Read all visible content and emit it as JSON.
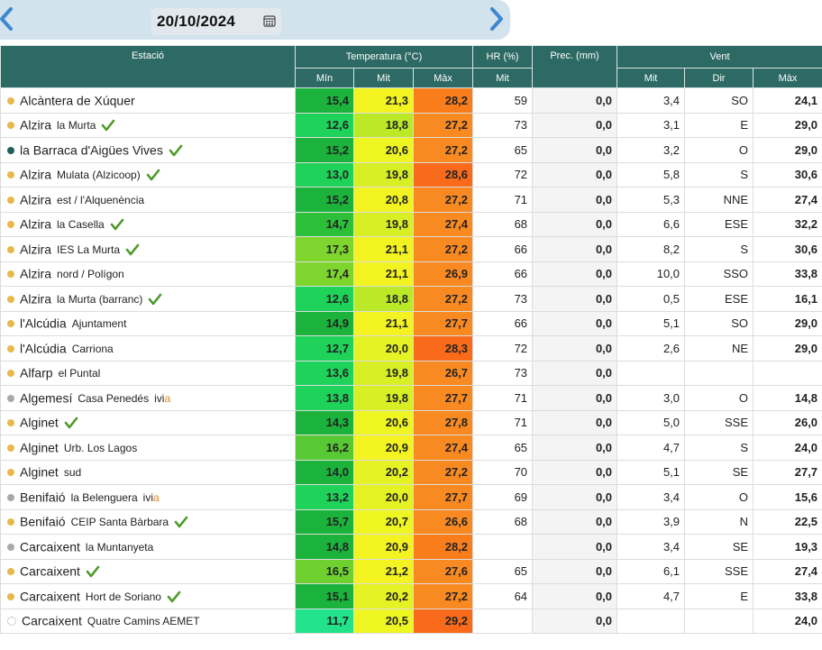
{
  "header": {
    "date": "20/10/2024",
    "prev_icon": "chevron-left-icon",
    "next_icon": "chevron-right-icon",
    "calendar_icon": "calendar-icon"
  },
  "columns": {
    "station": "Estació",
    "temperature": "Temperatura (°C)",
    "humidity": "HR (%)",
    "precipitation": "Prec. (mm)",
    "wind": "Vent",
    "t_min": "Mín",
    "t_mit": "Mit",
    "t_max": "Màx",
    "hr_mit": "Mit",
    "w_mit": "Mit",
    "w_dir": "Dir",
    "w_max": "Màx"
  },
  "colors": {
    "header_bg": "#2d6a65",
    "dot_yellow": "#e8b84a",
    "dot_teal": "#1e5f5a",
    "dot_gray": "#a9a9a9",
    "check": "#4c9a2a",
    "ivia_accent": "#e08a1e"
  },
  "stations": [
    {
      "name": "Alcàntera de Xúquer",
      "sub": "",
      "dot": "yellow",
      "check": false,
      "ivia": false,
      "tmin": "15,4",
      "tmit": "21,3",
      "tmax": "28,2",
      "hr": "59",
      "prec": "0,0",
      "wmit": "3,4",
      "wdir": "SO",
      "wmax": "24,1",
      "cmin": "#1bb33c",
      "cmit": "#f3f321",
      "cmax": "#fa7d1c"
    },
    {
      "name": "Alzira",
      "sub": "la Murta",
      "dot": "yellow",
      "check": true,
      "ivia": false,
      "tmin": "12,6",
      "tmit": "18,8",
      "tmax": "27,2",
      "hr": "73",
      "prec": "0,0",
      "wmit": "3,1",
      "wdir": "E",
      "wmax": "29,0",
      "cmin": "#1fd25a",
      "cmit": "#bbe928",
      "cmax": "#f98a22"
    },
    {
      "name": "la Barraca d'Aigües Vives",
      "sub": "",
      "dot": "teal",
      "check": true,
      "ivia": false,
      "tmin": "15,2",
      "tmit": "20,6",
      "tmax": "27,2",
      "hr": "65",
      "prec": "0,0",
      "wmit": "3,2",
      "wdir": "O",
      "wmax": "29,0",
      "cmin": "#1bb33c",
      "cmit": "#eef622",
      "cmax": "#f98a22"
    },
    {
      "name": "Alzira",
      "sub": "Mulata (Alzicoop)",
      "dot": "yellow",
      "check": true,
      "ivia": false,
      "tmin": "13,0",
      "tmit": "19,8",
      "tmax": "28,6",
      "hr": "72",
      "prec": "0,0",
      "wmit": "5,8",
      "wdir": "S",
      "wmax": "30,6",
      "cmin": "#1fd25a",
      "cmit": "#d8ef25",
      "cmax": "#f96a1a"
    },
    {
      "name": "Alzira",
      "sub": "est / l'Alquenència",
      "dot": "yellow",
      "check": false,
      "ivia": false,
      "tmin": "15,2",
      "tmit": "20,8",
      "tmax": "27,2",
      "hr": "71",
      "prec": "0,0",
      "wmit": "5,3",
      "wdir": "NNE",
      "wmax": "27,4",
      "cmin": "#1bb33c",
      "cmit": "#f3f321",
      "cmax": "#f98a22"
    },
    {
      "name": "Alzira",
      "sub": "la Casella",
      "dot": "yellow",
      "check": true,
      "ivia": false,
      "tmin": "14,7",
      "tmit": "19,8",
      "tmax": "27,4",
      "hr": "68",
      "prec": "0,0",
      "wmit": "6,6",
      "wdir": "ESE",
      "wmax": "32,2",
      "cmin": "#2cbf3a",
      "cmit": "#d8ef25",
      "cmax": "#f98a22"
    },
    {
      "name": "Alzira",
      "sub": "IES La Murta",
      "dot": "yellow",
      "check": true,
      "ivia": false,
      "tmin": "17,3",
      "tmit": "21,1",
      "tmax": "27,2",
      "hr": "66",
      "prec": "0,0",
      "wmit": "8,2",
      "wdir": "S",
      "wmax": "30,6",
      "cmin": "#7dd52e",
      "cmit": "#f3f321",
      "cmax": "#f98a22"
    },
    {
      "name": "Alzira",
      "sub": "nord / Polígon",
      "dot": "yellow",
      "check": false,
      "ivia": false,
      "tmin": "17,4",
      "tmit": "21,1",
      "tmax": "26,9",
      "hr": "66",
      "prec": "0,0",
      "wmit": "10,0",
      "wdir": "SSO",
      "wmax": "33,8",
      "cmin": "#7dd52e",
      "cmit": "#f3f321",
      "cmax": "#f98a22"
    },
    {
      "name": "Alzira",
      "sub": "la Murta (barranc)",
      "dot": "yellow",
      "check": true,
      "ivia": false,
      "tmin": "12,6",
      "tmit": "18,8",
      "tmax": "27,2",
      "hr": "73",
      "prec": "0,0",
      "wmit": "0,5",
      "wdir": "ESE",
      "wmax": "16,1",
      "cmin": "#1fd25a",
      "cmit": "#bbe928",
      "cmax": "#f98a22"
    },
    {
      "name": "l'Alcúdia",
      "sub": "Ajuntament",
      "dot": "yellow",
      "check": false,
      "ivia": false,
      "tmin": "14,9",
      "tmit": "21,1",
      "tmax": "27,7",
      "hr": "66",
      "prec": "0,0",
      "wmit": "5,1",
      "wdir": "SO",
      "wmax": "29,0",
      "cmin": "#1bb33c",
      "cmit": "#f3f321",
      "cmax": "#f98a22"
    },
    {
      "name": "l'Alcúdia",
      "sub": "Carriona",
      "dot": "yellow",
      "check": false,
      "ivia": false,
      "tmin": "12,7",
      "tmit": "20,0",
      "tmax": "28,3",
      "hr": "72",
      "prec": "0,0",
      "wmit": "2,6",
      "wdir": "NE",
      "wmax": "29,0",
      "cmin": "#1fd25a",
      "cmit": "#e5f223",
      "cmax": "#f96a1a"
    },
    {
      "name": "Alfarp",
      "sub": "el Puntal",
      "dot": "yellow",
      "check": false,
      "ivia": false,
      "tmin": "13,6",
      "tmit": "19,8",
      "tmax": "26,7",
      "hr": "73",
      "prec": "0,0",
      "wmit": "",
      "wdir": "",
      "wmax": "",
      "cmin": "#1fd25a",
      "cmit": "#d8ef25",
      "cmax": "#f98a22"
    },
    {
      "name": "Algemesí",
      "sub": "Casa Penedés",
      "dot": "gray",
      "check": false,
      "ivia": true,
      "tmin": "13,8",
      "tmit": "19,8",
      "tmax": "27,7",
      "hr": "71",
      "prec": "0,0",
      "wmit": "3,0",
      "wdir": "O",
      "wmax": "14,8",
      "cmin": "#1fd25a",
      "cmit": "#d8ef25",
      "cmax": "#f98a22"
    },
    {
      "name": "Alginet",
      "sub": "",
      "dot": "yellow",
      "check": true,
      "ivia": false,
      "tmin": "14,3",
      "tmit": "20,6",
      "tmax": "27,8",
      "hr": "71",
      "prec": "0,0",
      "wmit": "5,0",
      "wdir": "SSE",
      "wmax": "26,0",
      "cmin": "#1bb33c",
      "cmit": "#eef622",
      "cmax": "#f98a22"
    },
    {
      "name": "Alginet",
      "sub": "Urb. Los Lagos",
      "dot": "yellow",
      "check": false,
      "ivia": false,
      "tmin": "16,2",
      "tmit": "20,9",
      "tmax": "27,4",
      "hr": "65",
      "prec": "0,0",
      "wmit": "4,7",
      "wdir": "S",
      "wmax": "24,0",
      "cmin": "#58c935",
      "cmit": "#f3f321",
      "cmax": "#f98a22"
    },
    {
      "name": "Alginet",
      "sub": "sud",
      "dot": "yellow",
      "check": false,
      "ivia": false,
      "tmin": "14,0",
      "tmit": "20,2",
      "tmax": "27,2",
      "hr": "70",
      "prec": "0,0",
      "wmit": "5,1",
      "wdir": "SE",
      "wmax": "27,7",
      "cmin": "#1bb33c",
      "cmit": "#e5f223",
      "cmax": "#f98a22"
    },
    {
      "name": "Benifaió",
      "sub": "la Belenguera",
      "dot": "gray",
      "check": false,
      "ivia": true,
      "tmin": "13,2",
      "tmit": "20,0",
      "tmax": "27,7",
      "hr": "69",
      "prec": "0,0",
      "wmit": "3,4",
      "wdir": "O",
      "wmax": "15,6",
      "cmin": "#1fd25a",
      "cmit": "#e5f223",
      "cmax": "#f98a22"
    },
    {
      "name": "Benifaió",
      "sub": "CEIP Santa Bàrbara",
      "dot": "yellow",
      "check": true,
      "ivia": false,
      "tmin": "15,7",
      "tmit": "20,7",
      "tmax": "26,6",
      "hr": "68",
      "prec": "0,0",
      "wmit": "3,9",
      "wdir": "N",
      "wmax": "22,5",
      "cmin": "#1bb33c",
      "cmit": "#eef622",
      "cmax": "#f98a22"
    },
    {
      "name": "Carcaixent",
      "sub": "la Muntanyeta",
      "dot": "gray",
      "check": false,
      "ivia": false,
      "tmin": "14,8",
      "tmit": "20,9",
      "tmax": "28,2",
      "hr": "",
      "prec": "0,0",
      "wmit": "3,4",
      "wdir": "SE",
      "wmax": "19,3",
      "cmin": "#1bb33c",
      "cmit": "#f3f321",
      "cmax": "#fa7d1c"
    },
    {
      "name": "Carcaixent",
      "sub": "",
      "dot": "yellow",
      "check": true,
      "ivia": false,
      "tmin": "16,5",
      "tmit": "21,2",
      "tmax": "27,6",
      "hr": "65",
      "prec": "0,0",
      "wmit": "6,1",
      "wdir": "SSE",
      "wmax": "27,4",
      "cmin": "#6fd030",
      "cmit": "#f3f321",
      "cmax": "#f98a22"
    },
    {
      "name": "Carcaixent",
      "sub": "Hort de Soriano",
      "dot": "yellow",
      "check": true,
      "ivia": false,
      "tmin": "15,1",
      "tmit": "20,2",
      "tmax": "27,2",
      "hr": "64",
      "prec": "0,0",
      "wmit": "4,7",
      "wdir": "E",
      "wmax": "33,8",
      "cmin": "#1bb33c",
      "cmit": "#e5f223",
      "cmax": "#f98a22"
    },
    {
      "name": "Carcaixent",
      "sub": "Quatre Camins AEMET",
      "dot": "white",
      "check": false,
      "ivia": false,
      "tmin": "11,7",
      "tmit": "20,5",
      "tmax": "29,2",
      "hr": "",
      "prec": "0,0",
      "wmit": "",
      "wdir": "",
      "wmax": "24,0",
      "cmin": "#22e38a",
      "cmit": "#eef622",
      "cmax": "#f96a1a"
    }
  ],
  "ivia_label": "ivi",
  "ivia_suffix": "a"
}
